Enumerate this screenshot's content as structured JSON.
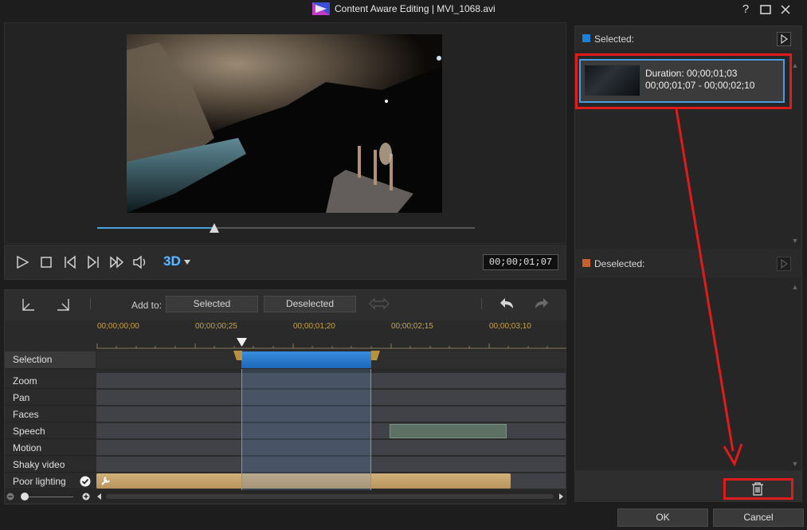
{
  "window": {
    "title": "Content Aware Editing  |  MVI_1068.avi",
    "help_label": "?"
  },
  "player": {
    "progress": 0.31,
    "timecode": "00;00;01;07",
    "threed_label": "3D"
  },
  "timeline": {
    "add_to_label": "Add to:",
    "selected_button": "Selected",
    "deselected_button": "Deselected",
    "ruler_ticks": [
      "00;00;00;00",
      "00;00;00;25",
      "00;00;01;20",
      "00;00;02;15",
      "00;00;03;10"
    ],
    "rows": [
      "Selection",
      "Zoom",
      "Pan",
      "Faces",
      "Speech",
      "Motion",
      "Shaky video",
      "Poor lighting"
    ]
  },
  "right_panel": {
    "selected_label": "Selected:",
    "deselected_label": "Deselected:",
    "selected_color": "#1e7fd8",
    "deselected_color": "#c8602a",
    "clip": {
      "duration": "Duration: 00;00;01;03",
      "range": "00;00;01;07 - 00;00;02;10"
    }
  },
  "dialog": {
    "ok": "OK",
    "cancel": "Cancel"
  },
  "annotations": {
    "color": "#e01b1b"
  }
}
